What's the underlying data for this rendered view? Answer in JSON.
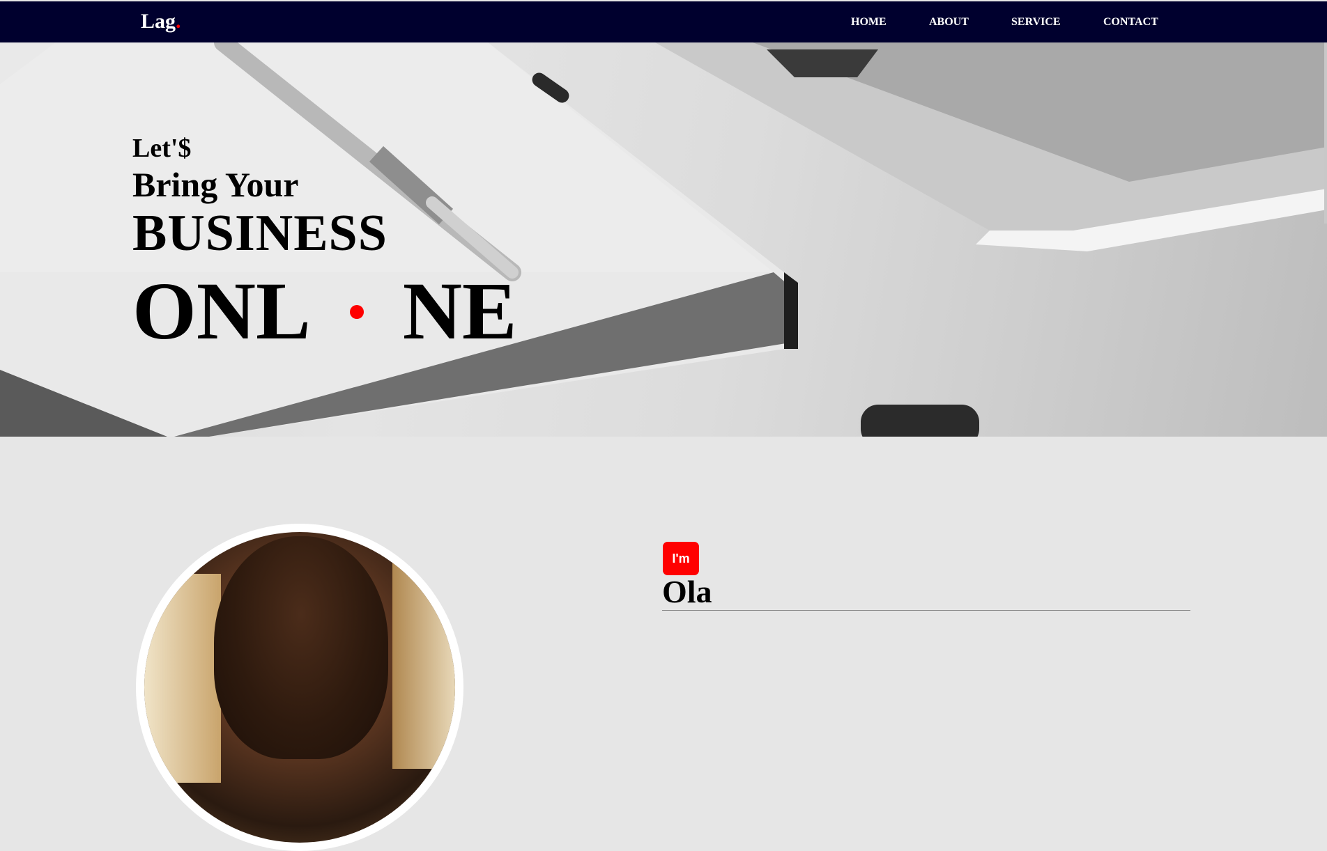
{
  "nav": {
    "logo_text": "Lag",
    "logo_dot": ".",
    "links": [
      "HOME",
      "ABOUT",
      "SERVICE",
      "CONTACT"
    ]
  },
  "hero": {
    "line1": "Let'$",
    "line2": "Bring Your",
    "line3": "BUSINESS",
    "line4_left": "ONL",
    "line4_right": "NE"
  },
  "about": {
    "badge": "I'm",
    "name": "Ola"
  },
  "colors": {
    "nav_bg": "#00002e",
    "accent": "#ff0000",
    "section_bg": "#e6e6e6"
  },
  "icons": {
    "logo_dot": "red-dot",
    "online_dot": "red-dot"
  }
}
